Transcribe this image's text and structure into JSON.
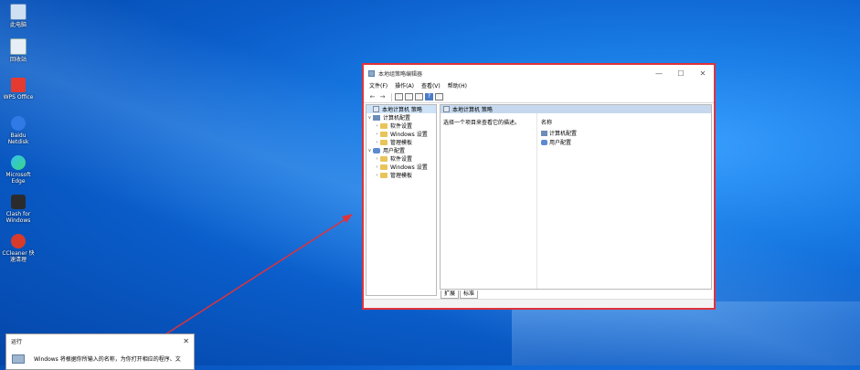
{
  "desktop": {
    "icons": [
      {
        "label": "此电脑"
      },
      {
        "label": "回收站"
      },
      {
        "label": "WPS Office"
      },
      {
        "label": "Baidu Netdisk"
      },
      {
        "label": "Microsoft Edge"
      },
      {
        "label": "Clash for Windows"
      },
      {
        "label": "CCleaner 快速清理"
      }
    ]
  },
  "window": {
    "title": "本地组策略编辑器",
    "controls": {
      "minimize": "—",
      "maximize": "☐",
      "close": "✕"
    },
    "menu": [
      "文件(F)",
      "操作(A)",
      "查看(V)",
      "帮助(H)"
    ],
    "tree": {
      "root": "本地计算机 策略",
      "computer": {
        "label": "计算机配置",
        "children": [
          "软件设置",
          "Windows 设置",
          "管理模板"
        ]
      },
      "user": {
        "label": "用户配置",
        "children": [
          "软件设置",
          "Windows 设置",
          "管理模板"
        ]
      }
    },
    "right": {
      "header": "本地计算机 策略",
      "description": "选择一个项目来查看它的描述。",
      "column_name": "名称",
      "items": [
        "计算机配置",
        "用户配置"
      ]
    },
    "tabs": [
      "扩展",
      "标准"
    ]
  },
  "run_dialog": {
    "title": "运行",
    "close": "✕",
    "text": "Windows 将根据你所输入的名称，为你打开相应的程序、文"
  },
  "colors": {
    "highlight": "#e0323a",
    "selection": "#cfe3f8"
  }
}
